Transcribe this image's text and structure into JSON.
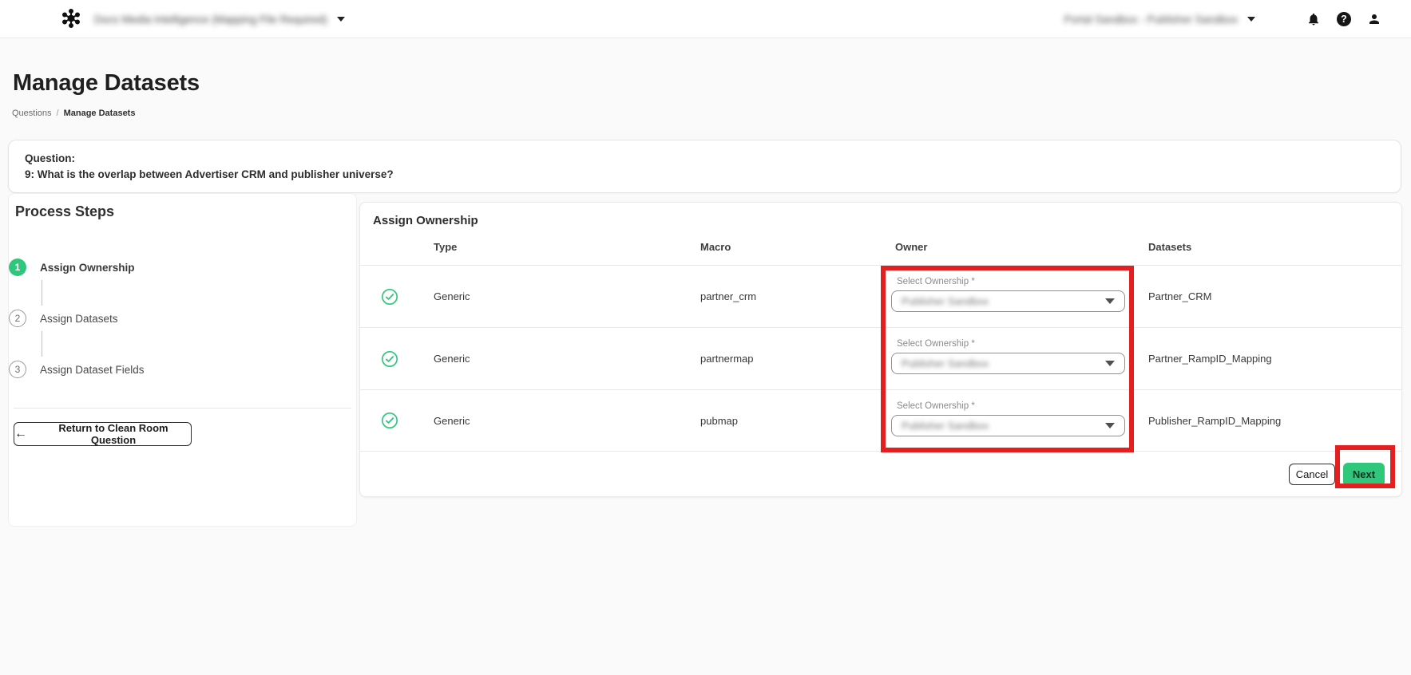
{
  "navbar": {
    "app_title": "Docs Media Intelligence (Mapping File Required)",
    "environment": "Portal Sandbox - Publisher Sandbox"
  },
  "page": {
    "title": "Manage Datasets",
    "breadcrumb": {
      "parent": "Questions",
      "separator": "/",
      "current": "Manage Datasets"
    }
  },
  "question": {
    "label": "Question:",
    "text": "9: What is the overlap between Advertiser CRM and publisher universe?"
  },
  "process": {
    "title": "Process Steps",
    "steps": [
      {
        "number": "1",
        "label": "Assign Ownership",
        "state": "active"
      },
      {
        "number": "2",
        "label": "Assign Datasets",
        "state": "idle"
      },
      {
        "number": "3",
        "label": "Assign Dataset Fields",
        "state": "idle"
      }
    ],
    "return_label": "Return to Clean Room Question",
    "return_arrow": "←"
  },
  "panel": {
    "title": "Assign Ownership",
    "columns": {
      "type": "Type",
      "macro": "Macro",
      "owner": "Owner",
      "datasets": "Datasets"
    },
    "rows": [
      {
        "type": "Generic",
        "macro": "partner_crm",
        "owner_label": "Select Ownership *",
        "owner_value": "Publisher Sandbox",
        "dataset": "Partner_CRM"
      },
      {
        "type": "Generic",
        "macro": "partnermap",
        "owner_label": "Select Ownership *",
        "owner_value": "Publisher Sandbox",
        "dataset": "Partner_RampID_Mapping"
      },
      {
        "type": "Generic",
        "macro": "pubmap",
        "owner_label": "Select Ownership *",
        "owner_value": "Publisher Sandbox",
        "dataset": "Publisher_RampID_Mapping"
      }
    ],
    "footer": {
      "cancel": "Cancel",
      "next": "Next"
    }
  },
  "colors": {
    "green": "#2ec77b",
    "red": "#e41f1f"
  }
}
